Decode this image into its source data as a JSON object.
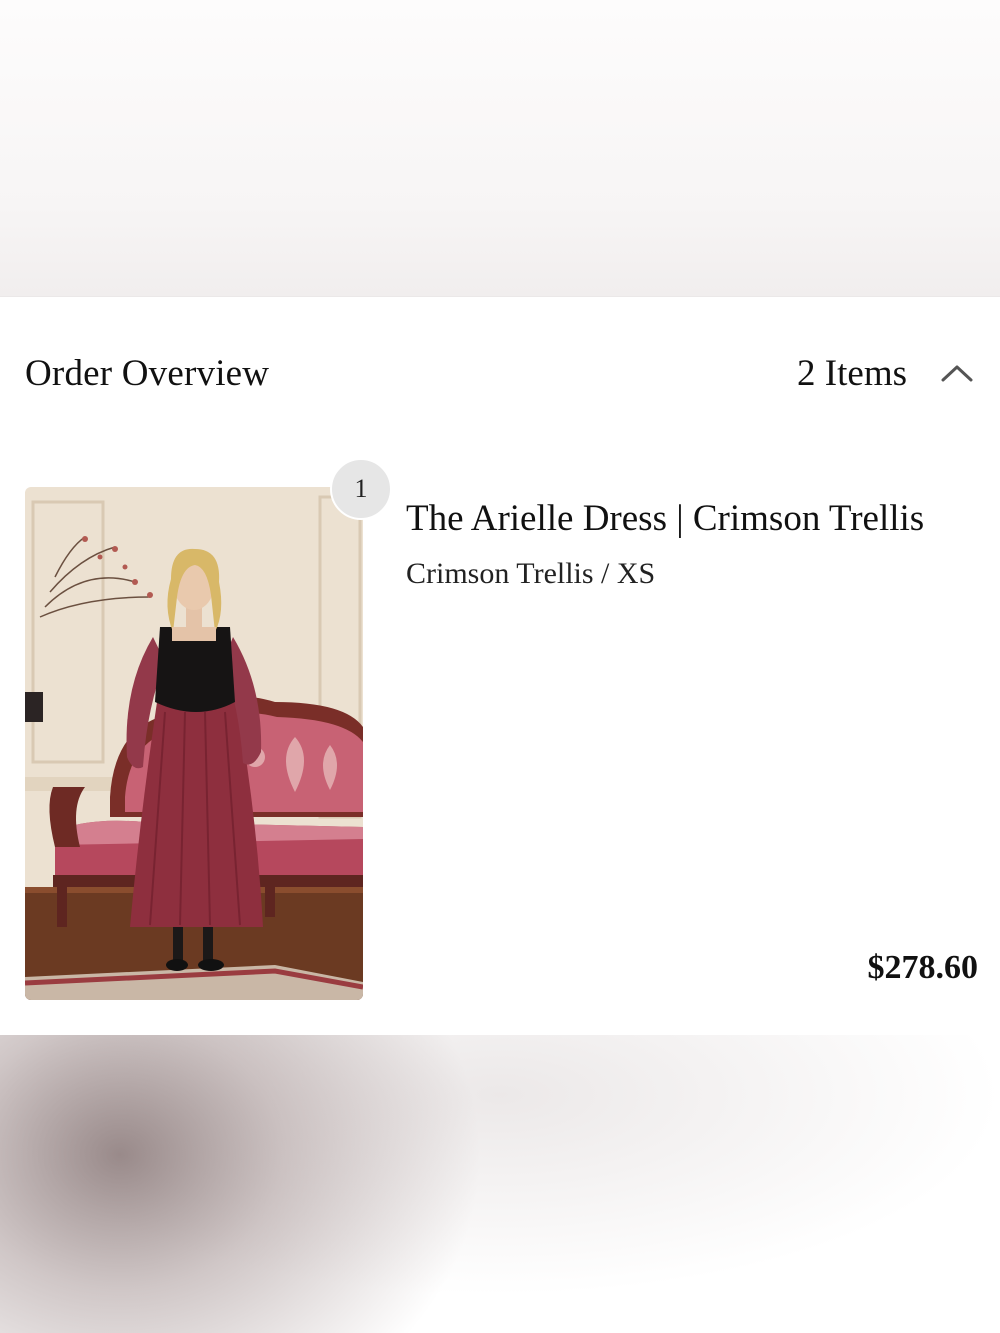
{
  "order": {
    "title": "Order Overview",
    "item_count": "2 Items",
    "toggle_icon": "chevron-up-icon"
  },
  "items": [
    {
      "quantity": "1",
      "name": "The Arielle Dress | Crimson Trellis",
      "variant": "Crimson Trellis / XS",
      "price": "$278.60",
      "image_desc_colors": {
        "dress": "#8e2f3e",
        "bodice": "#161414",
        "wall": "#e9dccb",
        "sofa": "#b4475a"
      }
    }
  ]
}
